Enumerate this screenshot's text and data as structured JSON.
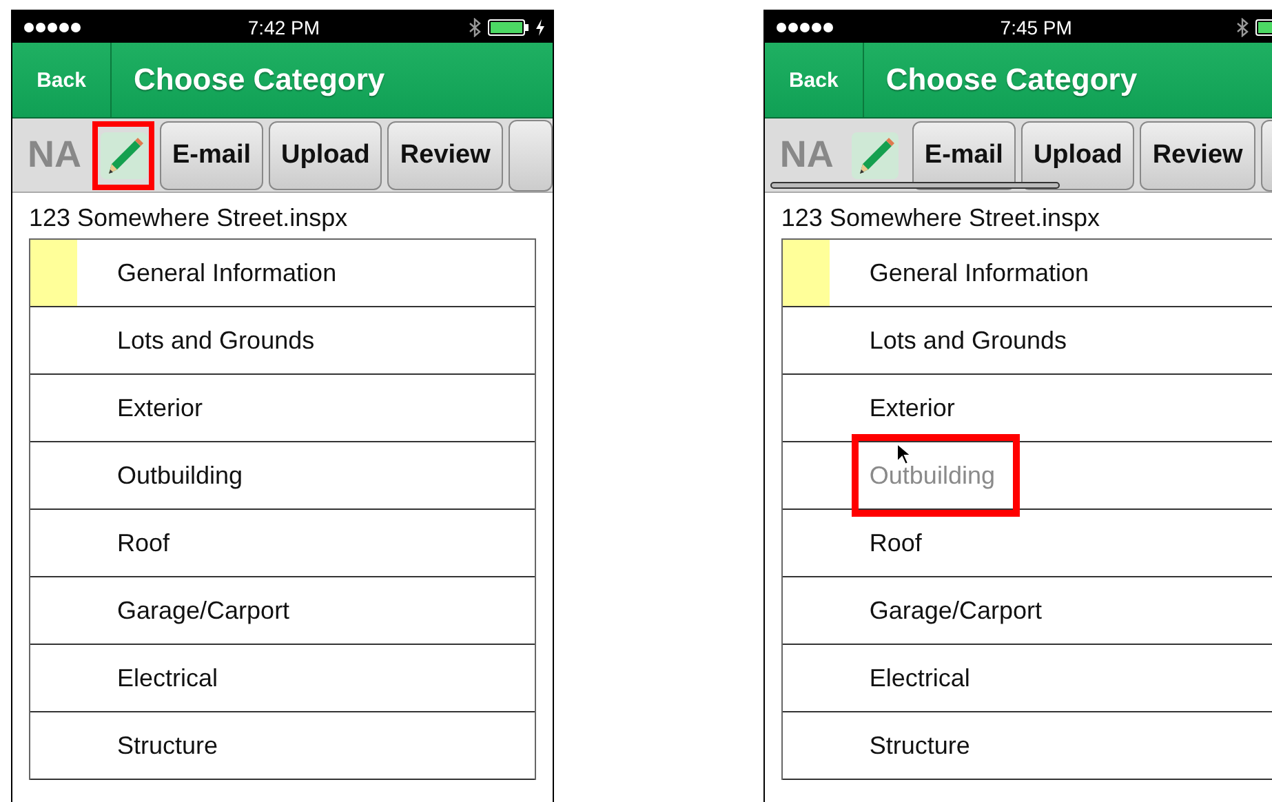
{
  "phones": [
    {
      "status_bar": {
        "time": "7:42 PM",
        "charging": true
      },
      "nav": {
        "back": "Back",
        "title": "Choose Category"
      },
      "toolbar": {
        "na_label": "NA",
        "edit_highlighted": true,
        "scrolling": false,
        "buttons": [
          "E-mail",
          "Upload",
          "Review"
        ]
      },
      "file_name": "123 Somewhere Street.inspx",
      "categories": [
        {
          "name": "General Information",
          "marked": true,
          "dragging": false
        },
        {
          "name": "Lots and Grounds",
          "marked": false,
          "dragging": false
        },
        {
          "name": "Exterior",
          "marked": false,
          "dragging": false
        },
        {
          "name": "Outbuilding",
          "marked": false,
          "dragging": false
        },
        {
          "name": "Roof",
          "marked": false,
          "dragging": false
        },
        {
          "name": "Garage/Carport",
          "marked": false,
          "dragging": false
        },
        {
          "name": "Electrical",
          "marked": false,
          "dragging": false
        },
        {
          "name": "Structure",
          "marked": false,
          "dragging": false
        }
      ]
    },
    {
      "status_bar": {
        "time": "7:45 PM"
      },
      "nav": {
        "back": "Back",
        "title": "Choose Category"
      },
      "toolbar": {
        "na_label": "NA",
        "edit_highlighted": false,
        "scrolling": true,
        "buttons": [
          "E-mail",
          "Upload",
          "Review"
        ]
      },
      "file_name": "123 Somewhere Street.inspx",
      "categories": [
        {
          "name": "General Information",
          "marked": true,
          "dragging": false
        },
        {
          "name": "Lots and Grounds",
          "marked": false,
          "dragging": false
        },
        {
          "name": "Exterior",
          "marked": false,
          "dragging": false
        },
        {
          "name": "Outbuilding",
          "marked": false,
          "dragging": true
        },
        {
          "name": "Roof",
          "marked": false,
          "dragging": false
        },
        {
          "name": "Garage/Carport",
          "marked": false,
          "dragging": false
        },
        {
          "name": "Electrical",
          "marked": false,
          "dragging": false
        },
        {
          "name": "Structure",
          "marked": false,
          "dragging": false
        }
      ]
    }
  ]
}
